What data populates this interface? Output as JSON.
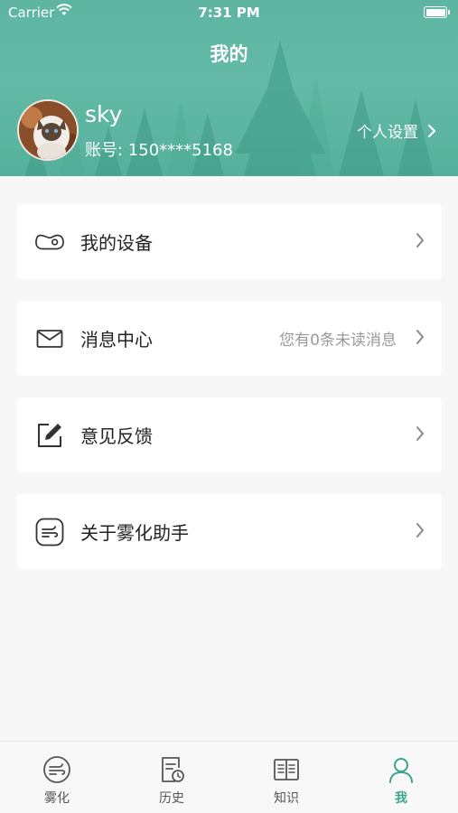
{
  "status_bar": {
    "carrier": "Carrier",
    "time": "7:31 PM"
  },
  "header": {
    "title": "我的"
  },
  "profile": {
    "username": "sky",
    "account": "账号: 150****5168",
    "settings_label": "个人设置"
  },
  "menu": [
    {
      "label": "我的设备",
      "icon": "device-icon",
      "hint": ""
    },
    {
      "label": "消息中心",
      "icon": "mail-icon",
      "hint": "您有0条未读消息"
    },
    {
      "label": "意见反馈",
      "icon": "feedback-edit-icon",
      "hint": ""
    },
    {
      "label": "关于雾化助手",
      "icon": "nebulizer-icon",
      "hint": ""
    }
  ],
  "tabbar": {
    "tabs": [
      {
        "label": "雾化",
        "icon": "nebulizer-tab-icon"
      },
      {
        "label": "历史",
        "icon": "history-icon"
      },
      {
        "label": "知识",
        "icon": "book-icon"
      },
      {
        "label": "我",
        "icon": "person-icon"
      }
    ],
    "active_index": 3
  },
  "colors": {
    "accent": "#3aa58d",
    "header": "#52b19b",
    "background": "#f7f7f7"
  }
}
